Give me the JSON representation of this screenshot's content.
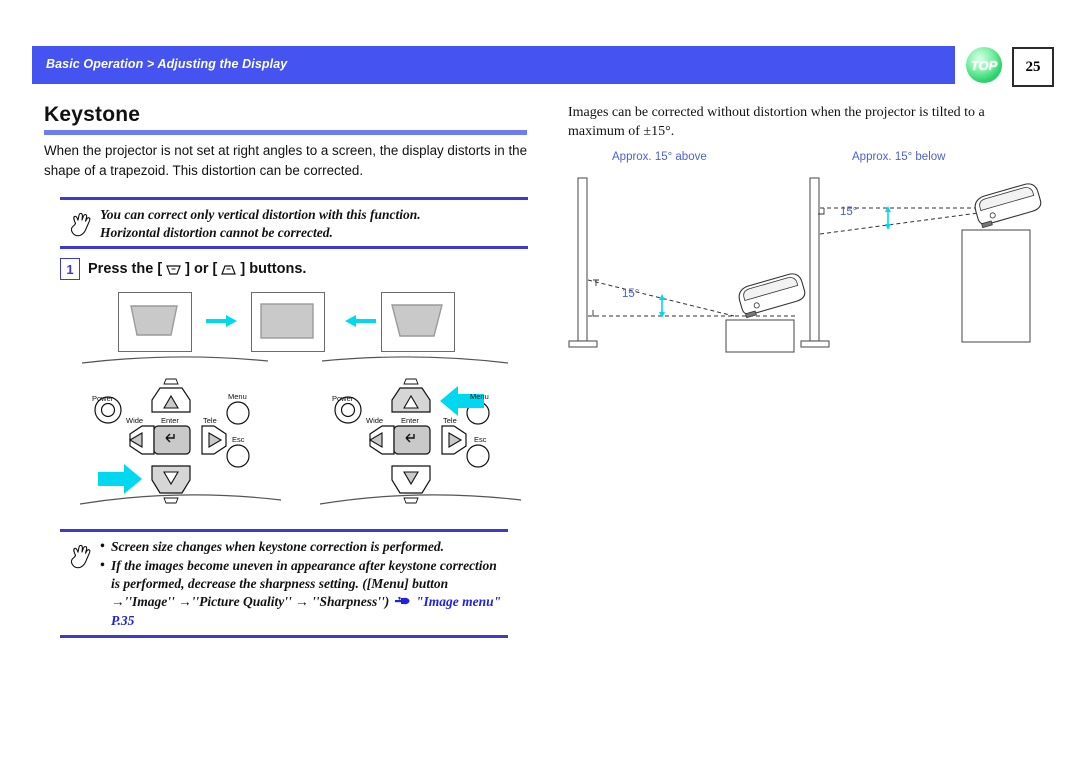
{
  "header": {
    "breadcrumb": "Basic Operation > Adjusting the Display",
    "top_badge": "TOP",
    "page_number": "25",
    "bar_color": "#4553f0",
    "badge_color": "#2fd46e"
  },
  "left": {
    "title": "Keystone",
    "title_rule_color": "#6d7cf0",
    "intro": "When the projector is not set at right angles to a screen, the display distorts in the shape of a trapezoid. This distortion can be corrected.",
    "note_top": {
      "icon": "pointing-hand-icon",
      "lines": [
        "You can correct only vertical distortion with this function.",
        "Horizontal distortion cannot be corrected."
      ]
    },
    "step": {
      "number": "1",
      "text_before": "Press the [",
      "text_middle": "] or [",
      "text_after": "] buttons.",
      "icon_1": "keystone-down-icon",
      "icon_2": "keystone-up-icon"
    },
    "figures": {
      "left_panel": "trapezoid-narrow-bottom",
      "middle_panel": "rectangle-corrected",
      "right_panel": "trapezoid-narrow-bottom-deep",
      "arrow_right": "arrow-right-cyan",
      "arrow_left": "arrow-left-cyan"
    },
    "control_panel_left": {
      "labels": [
        "Power",
        "Wide",
        "Enter",
        "Tele",
        "Menu",
        "Esc"
      ],
      "highlight": "down-button",
      "pointer": "arrow-right-cyan"
    },
    "control_panel_right": {
      "labels": [
        "Power",
        "Wide",
        "Enter",
        "Tele",
        "Menu",
        "Esc"
      ],
      "highlight": "up-button",
      "pointer": "arrow-left-cyan"
    },
    "note_bottom": {
      "icon": "pointing-hand-icon",
      "bullets": [
        "Screen size changes when keystone correction is performed.",
        "If the images become uneven in appearance after keystone correction is performed,  decrease the sharpness setting. ([Menu] button →''Image'' →''Picture Quality'' → ''Sharpness'')"
      ],
      "link_icon": "pointing-hand-link-icon",
      "link_text": "\"Image menu\" P.35",
      "link_color": "#2222dd"
    }
  },
  "right": {
    "intro": "Images can be corrected without distortion when the projector is tilted to a maximum of ±15°.",
    "label_left": "Approx. 15° above",
    "label_right": "Approx. 15° below",
    "angle_left": "15°",
    "angle_right": "15°",
    "label_color": "#4a62cf",
    "accent_cyan": "#00d8f0"
  }
}
